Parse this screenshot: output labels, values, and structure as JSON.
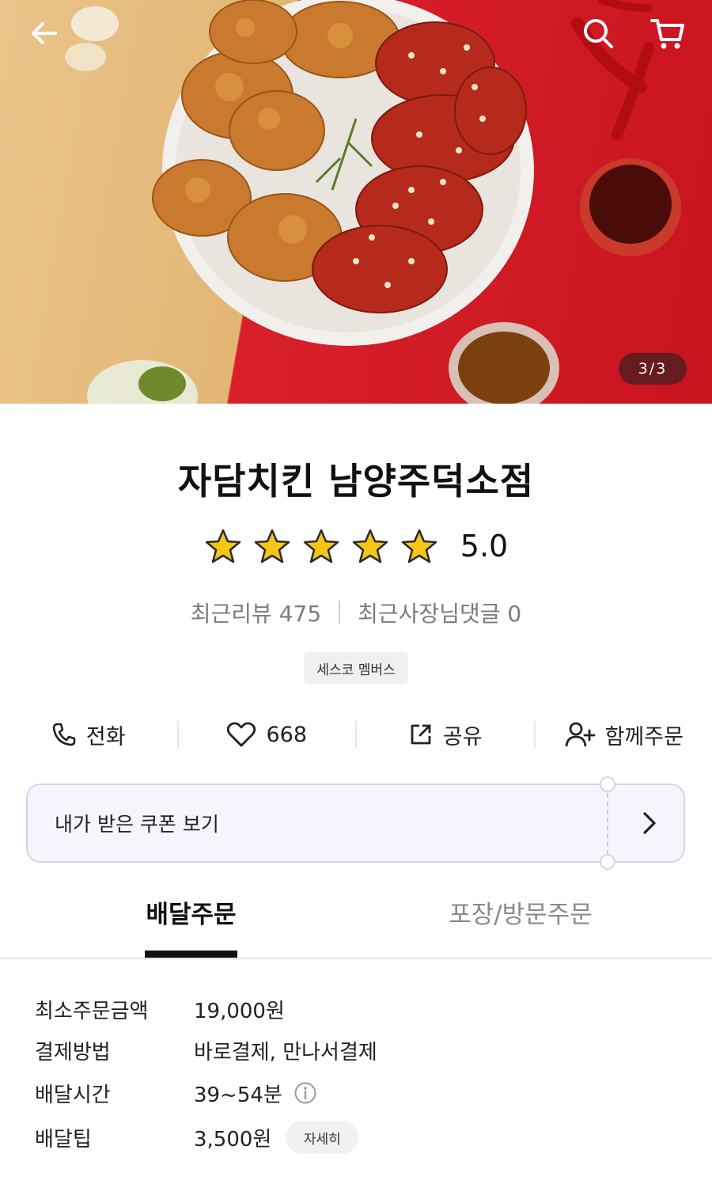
{
  "hero": {
    "image_counter": "3/3",
    "image_description_icon": "fried-chicken-photo"
  },
  "header": {
    "back_icon": "back-arrow-icon",
    "search_icon": "search-icon",
    "cart_icon": "cart-icon"
  },
  "store": {
    "name": "자담치킨 남양주덕소점",
    "rating": "5.0",
    "stars": 5,
    "recent_reviews_label": "최근리뷰",
    "recent_reviews_count": "475",
    "owner_replies_label": "최근사장님댓글",
    "owner_replies_count": "0",
    "member_badge": "세스코 멤버스"
  },
  "actions": [
    {
      "label": "전화",
      "icon": "phone-icon"
    },
    {
      "label": "668",
      "icon": "heart-icon"
    },
    {
      "label": "공유",
      "icon": "share-icon"
    },
    {
      "label": "함께주문",
      "icon": "add-person-icon"
    }
  ],
  "coupon": {
    "label": "내가 받은 쿠폰 보기"
  },
  "tabs": [
    {
      "label": "배달주문",
      "active": true
    },
    {
      "label": "포장/방문주문",
      "active": false
    }
  ],
  "info": {
    "min_order_label": "최소주문금액",
    "min_order_value": "19,000원",
    "payment_label": "결제방법",
    "payment_value": "바로결제, 만나서결제",
    "delivery_time_label": "배달시간",
    "delivery_time_value": "39~54분",
    "delivery_tip_label": "배달팁",
    "delivery_tip_value": "3,500원",
    "detail_button": "자세히"
  },
  "colors": {
    "accent_purple_bg": "#f6f4fd",
    "accent_purple_border": "#d7d2ec",
    "star": "#f5c518",
    "hero_red": "#c8141f",
    "hero_yellow": "#e6bd7f"
  }
}
